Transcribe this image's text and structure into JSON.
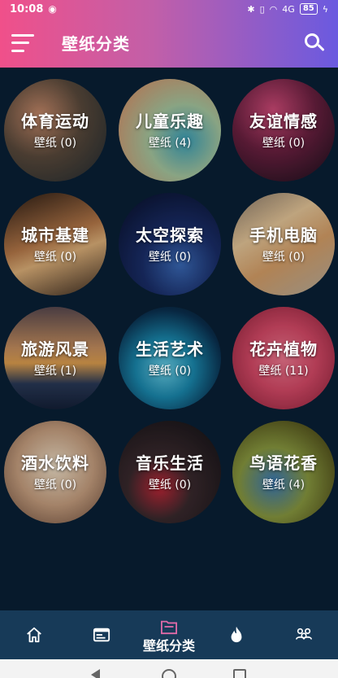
{
  "status_bar": {
    "time": "10:08",
    "battery": "85",
    "signal": "4G"
  },
  "app_bar": {
    "title": "壁纸分类",
    "menu_icon": "menu-icon",
    "search_icon": "search-icon"
  },
  "categories": [
    {
      "name": "体育运动",
      "count": "壁纸 (0)"
    },
    {
      "name": "儿童乐趣",
      "count": "壁纸 (4)"
    },
    {
      "name": "友谊情感",
      "count": "壁纸 (0)"
    },
    {
      "name": "城市基建",
      "count": "壁纸 (0)"
    },
    {
      "name": "太空探索",
      "count": "壁纸 (0)"
    },
    {
      "name": "手机电脑",
      "count": "壁纸 (0)"
    },
    {
      "name": "旅游风景",
      "count": "壁纸 (1)"
    },
    {
      "name": "生活艺术",
      "count": "壁纸 (0)"
    },
    {
      "name": "花卉植物",
      "count": "壁纸 (11)"
    },
    {
      "name": "酒水饮料",
      "count": "壁纸 (0)"
    },
    {
      "name": "音乐生活",
      "count": "壁纸 (0)"
    },
    {
      "name": "鸟语花香",
      "count": "壁纸 (4)"
    }
  ],
  "bottom_nav": {
    "active_label": "壁纸分类",
    "items": [
      "home-icon",
      "wallpaper-icon",
      "category-icon",
      "fire-icon",
      "community-icon"
    ]
  },
  "colors": {
    "header_start": "#f0508a",
    "header_end": "#6a5ae0",
    "background": "#071a2c",
    "nav_bg": "#173a58",
    "active_icon": "#e06aa8"
  }
}
